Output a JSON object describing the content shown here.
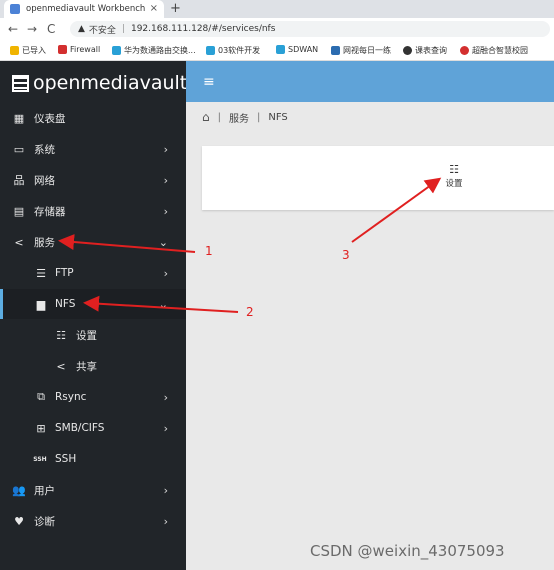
{
  "browser": {
    "tab_title": "openmediavault Workbench",
    "tab_close": "×",
    "new_tab": "+",
    "back": "←",
    "forward": "→",
    "reload": "C",
    "insecure": "不安全",
    "url": "192.168.111.128/#/services/nfs",
    "bookmarks": [
      {
        "label": "已导入",
        "color": "#f0b400"
      },
      {
        "label": "Firewall",
        "color": "#d32f2f"
      },
      {
        "label": "华为数通路由交换...",
        "color": "#29a0d6"
      },
      {
        "label": "03软件开发",
        "color": "#29a0d6"
      },
      {
        "label": "SDWAN",
        "color": "#29a0d6"
      },
      {
        "label": "网视每日一练",
        "color": "#2b6cb0"
      },
      {
        "label": "课表查询",
        "color": "#333333"
      },
      {
        "label": "超融合智慧校园",
        "color": "#d32f2f"
      }
    ]
  },
  "sidebar": {
    "brand": "openmediavault",
    "items": [
      {
        "label": "仪表盘",
        "icon": "dashboard-icon",
        "glyph": "▦"
      },
      {
        "label": "系统",
        "icon": "laptop-icon",
        "glyph": "▭",
        "chevron": "›"
      },
      {
        "label": "网络",
        "icon": "network-icon",
        "glyph": "品",
        "chevron": "›"
      },
      {
        "label": "存储器",
        "icon": "storage-icon",
        "glyph": "▤",
        "chevron": "›"
      },
      {
        "label": "服务",
        "icon": "share-icon",
        "glyph": "<",
        "chevron": "⌄"
      },
      {
        "label": "FTP",
        "icon": "server-icon",
        "glyph": "☰",
        "chevron": "›"
      },
      {
        "label": "NFS",
        "icon": "folder-network-icon",
        "glyph": "▆",
        "chevron": "⌄"
      },
      {
        "label": "设置",
        "icon": "sliders-icon",
        "glyph": "☷"
      },
      {
        "label": "共享",
        "icon": "share-icon",
        "glyph": "<"
      },
      {
        "label": "Rsync",
        "icon": "rsync-icon",
        "glyph": "⧉",
        "chevron": "›"
      },
      {
        "label": "SMB/CIFS",
        "icon": "windows-icon",
        "glyph": "⊞",
        "chevron": "›"
      },
      {
        "label": "SSH",
        "icon": "ssh-icon",
        "glyph": "SSH"
      },
      {
        "label": "用户",
        "icon": "users-icon",
        "glyph": "👥",
        "chevron": "›"
      },
      {
        "label": "诊断",
        "icon": "heartbeat-icon",
        "glyph": "♥",
        "chevron": "›"
      }
    ]
  },
  "header": {
    "menu_glyph": "≡"
  },
  "breadcrumb": {
    "home_glyph": "⌂",
    "sep": "|",
    "services": "服务",
    "current": "NFS"
  },
  "card": {
    "tile_glyph": "☷",
    "tile_label": "设置"
  },
  "annotations": {
    "one": "1",
    "two": "2",
    "three": "3",
    "color": "#e02020"
  },
  "watermark": "CSDN @weixin_43075093"
}
